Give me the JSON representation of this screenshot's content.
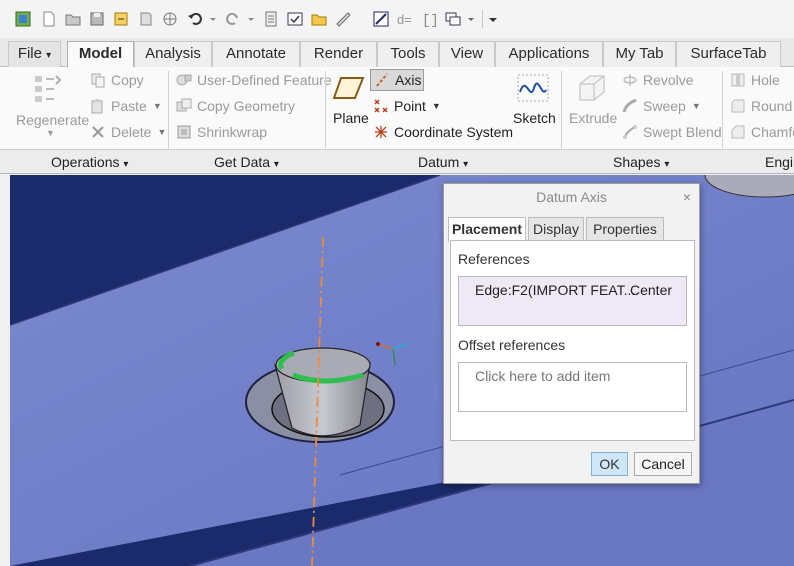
{
  "quick_access": {
    "icons": [
      "window-icon",
      "new-icon",
      "open-icon",
      "save-icon",
      "regenerate-icon",
      "close-window-icon",
      "system-icon",
      "undo-icon",
      "redo-icon",
      "regen-all-icon",
      "verify-icon",
      "open-folder-icon",
      "measure-icon",
      "family-table-icon",
      "relations-icon",
      "parameters-icon",
      "windows-icon",
      "customize-icon"
    ]
  },
  "tabs": [
    {
      "label": "File",
      "caret": "▾"
    },
    {
      "label": "Model"
    },
    {
      "label": "Analysis"
    },
    {
      "label": "Annotate"
    },
    {
      "label": "Render"
    },
    {
      "label": "Tools"
    },
    {
      "label": "View"
    },
    {
      "label": "Applications"
    },
    {
      "label": "My Tab"
    },
    {
      "label": "SurfaceTab"
    }
  ],
  "ribbon": {
    "operations": {
      "regenerate": "Regenerate",
      "copy": "Copy",
      "paste": "Paste",
      "delete": "Delete"
    },
    "get_data": {
      "user_defined_feature": "User-Defined Feature",
      "copy_geometry": "Copy Geometry",
      "shrinkwrap": "Shrinkwrap"
    },
    "datum": {
      "plane": "Plane",
      "axis": "Axis",
      "point": "Point",
      "coordinate_system": "Coordinate System",
      "sketch": "Sketch"
    },
    "shapes": {
      "extrude": "Extrude",
      "revolve": "Revolve",
      "sweep": "Sweep",
      "swept_blend": "Swept Blend"
    },
    "engineering": {
      "hole": "Hole",
      "round": "Round",
      "chamfer": "Chamfe"
    }
  },
  "groups": {
    "operations": "Operations",
    "get_data": "Get Data",
    "datum": "Datum",
    "shapes": "Shapes",
    "engineering": "Engin",
    "caret": "▾"
  },
  "dialog": {
    "title": "Datum Axis",
    "close": "×",
    "tabs": [
      "Placement",
      "Display",
      "Properties"
    ],
    "references_label": "References",
    "reference_item": "Edge:F2(IMPORT FEAT...",
    "reference_constraint": "Center",
    "offset_label": "Offset references",
    "offset_placeholder": "Click here to add item",
    "ok": "OK",
    "cancel": "Cancel"
  },
  "colors": {
    "accent_blue": "#1a66c9",
    "model_surface": "#6e7ec6",
    "background": "#1b2a6b",
    "axis_orange": "#f08a3a",
    "edge_highlight": "#2fbf4f"
  }
}
